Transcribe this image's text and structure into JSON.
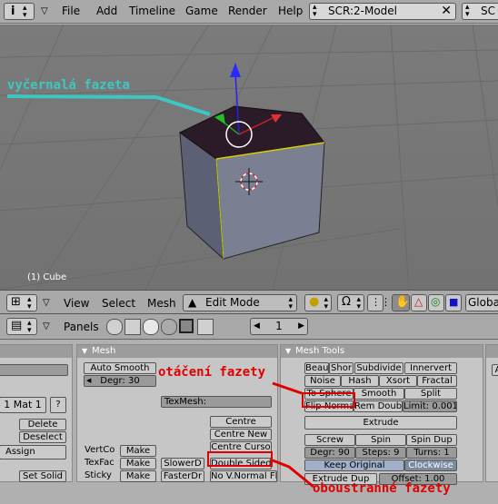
{
  "topbar": {
    "menus": [
      "File",
      "Add",
      "Timeline",
      "Game",
      "Render",
      "Help"
    ],
    "screen": "SCR:2-Model",
    "scene_partial": "SC"
  },
  "viewport": {
    "object_label": "(1) Cube",
    "annotation": "vyčernalá fazeta"
  },
  "vp_header": {
    "menus": [
      "View",
      "Select",
      "Mesh"
    ],
    "mode": "Edit Mode",
    "global_partial": "Globa"
  },
  "btn_header": {
    "panels_label": "Panels",
    "frame": "1"
  },
  "left_panel": {
    "mat": "1 Mat 1",
    "q": "?",
    "delete": "Delete",
    "deselect": "Deselect",
    "assign": "Assign",
    "set_solid": "Set Solid"
  },
  "mesh_panel": {
    "title": "Mesh",
    "auto_smooth": "Auto Smooth",
    "degr": "Degr: 30",
    "texmesh": "TexMesh:",
    "centre": "Centre",
    "centre_new": "Centre New",
    "centre_cursor": "Centre Curso",
    "vertco": "VertCo",
    "texfac": "TexFac",
    "sticky": "Sticky",
    "make": "Make",
    "slowerd": "SlowerD",
    "fasterdr": "FasterDr",
    "double_sided": "Double Sided",
    "no_vnormal": "No V.Normal Fl"
  },
  "tools_panel": {
    "title": "Mesh Tools",
    "row1": [
      "Beaut",
      "Shor",
      "Subdivide",
      "Innervert"
    ],
    "row2": [
      "Noise",
      "Hash",
      "Xsort",
      "Fractal"
    ],
    "row3": [
      "To Sphere",
      "Smooth",
      "Split"
    ],
    "row4": [
      "Flip Normal",
      "Rem Doubl",
      "Limit: 0.001"
    ],
    "extrude": "Extrude",
    "row6": [
      "Screw",
      "Spin",
      "Spin Dup"
    ],
    "row7": [
      "Degr: 90",
      "Steps: 9",
      "Turns: 1"
    ],
    "keep_original": "Keep Original",
    "clockwise": "Clockwise",
    "extrude_dup": "Extrude Dup",
    "offset": "Offset: 1.00"
  },
  "annotations": {
    "flip": "otáčení fazety",
    "double": "oboustranné fazety"
  },
  "colors": {
    "annotation_cyan": "#3cc8c0",
    "annotation_red": "#e00000",
    "cube_side": "#5c6173",
    "cube_top": "#2a1a26"
  }
}
